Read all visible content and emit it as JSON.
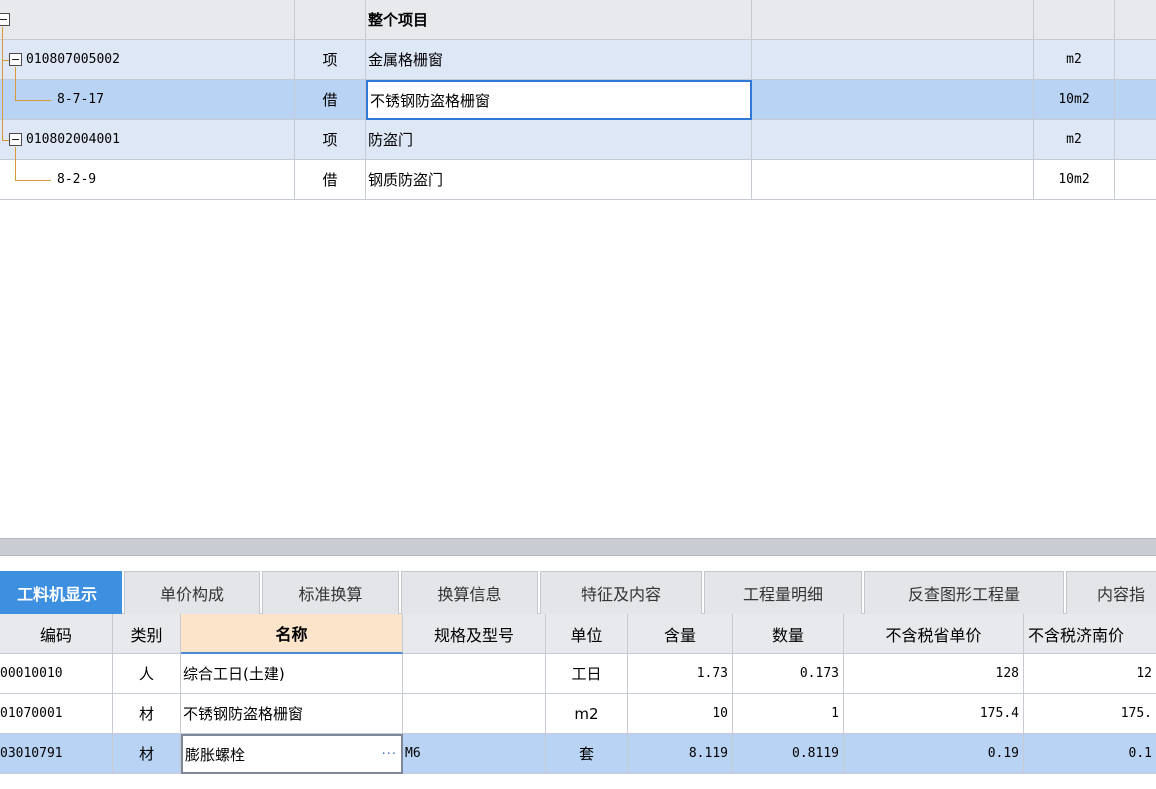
{
  "upper_grid": {
    "header": {
      "name": "整个项目"
    },
    "rows": [
      {
        "code": "010807005002",
        "type": "项",
        "name": "金属格栅窗",
        "unit": "m2"
      },
      {
        "code": "8-7-17",
        "type": "借",
        "name": "不锈钢防盗格栅窗",
        "unit": "10m2"
      },
      {
        "code": "010802004001",
        "type": "项",
        "name": "防盗门",
        "unit": "m2"
      },
      {
        "code": "8-2-9",
        "type": "借",
        "name": "钢质防盗门",
        "unit": "10m2"
      }
    ]
  },
  "tabs": [
    {
      "label": "工料机显示",
      "active": true
    },
    {
      "label": "单价构成"
    },
    {
      "label": "标准换算"
    },
    {
      "label": "换算信息"
    },
    {
      "label": "特征及内容"
    },
    {
      "label": "工程量明细"
    },
    {
      "label": "反查图形工程量"
    },
    {
      "label": "内容指"
    }
  ],
  "lower_grid": {
    "columns": [
      "编码",
      "类别",
      "名称",
      "规格及型号",
      "单位",
      "含量",
      "数量",
      "不含税省单价",
      "不含税济南价"
    ],
    "rows": [
      {
        "code": "00010010",
        "category": "人",
        "name": "综合工日(土建)",
        "spec": "",
        "unit": "工日",
        "content": "1.73",
        "quantity": "0.173",
        "province_price": "128",
        "jinan_price": "12"
      },
      {
        "code": "01070001",
        "category": "材",
        "name": "不锈钢防盗格栅窗",
        "spec": "",
        "unit": "m2",
        "content": "10",
        "quantity": "1",
        "province_price": "175.4",
        "jinan_price": "175."
      },
      {
        "code": "03010791",
        "category": "材",
        "name": "膨胀螺栓",
        "spec": "M6",
        "unit": "套",
        "content": "8.119",
        "quantity": "0.8119",
        "province_price": "0.19",
        "jinan_price": "0.1",
        "edit_button": "···"
      }
    ]
  }
}
